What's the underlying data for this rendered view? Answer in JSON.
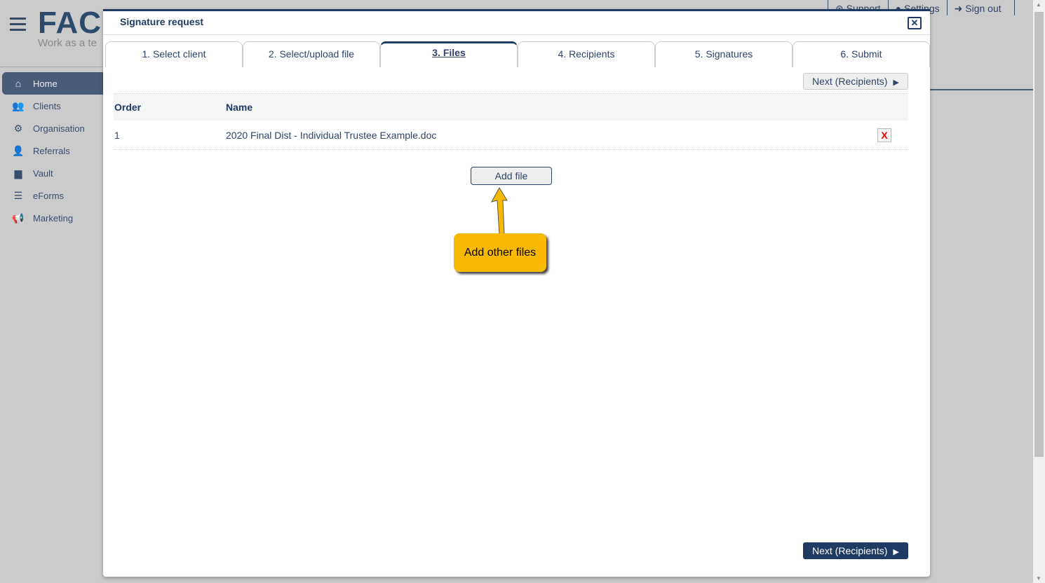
{
  "app": {
    "logo": "FAC",
    "tagline": "Work as a te"
  },
  "sidebar": {
    "items": [
      {
        "label": "Home",
        "icon": "home-icon",
        "active": true
      },
      {
        "label": "Clients",
        "icon": "users-icon"
      },
      {
        "label": "Organisation",
        "icon": "users-cog-icon"
      },
      {
        "label": "Referrals",
        "icon": "user-friends-icon"
      },
      {
        "label": "Vault",
        "icon": "archive-icon"
      },
      {
        "label": "eForms",
        "icon": "list-icon"
      },
      {
        "label": "Marketing",
        "icon": "bullhorn-icon"
      }
    ]
  },
  "topnav": {
    "support": "Support",
    "settings": "Settings",
    "signout": "Sign out"
  },
  "modal": {
    "title": "Signature request",
    "close": "✕",
    "tabs": [
      "1. Select client",
      "2. Select/upload file",
      "3. Files",
      "4. Recipients",
      "5. Signatures",
      "6. Submit"
    ],
    "active_tab": 2,
    "next_label": "Next (Recipients)",
    "table": {
      "headers": [
        "Order",
        "Name"
      ],
      "rows": [
        {
          "order": "1",
          "name": "2020 Final Dist - Individual Trustee Example.doc",
          "delete": "X"
        }
      ]
    },
    "add_file": "Add file",
    "callout": "Add other files",
    "colors": {
      "primary": "#1f3a63",
      "callout": "#f9b900",
      "delete": "#ee0000"
    }
  }
}
